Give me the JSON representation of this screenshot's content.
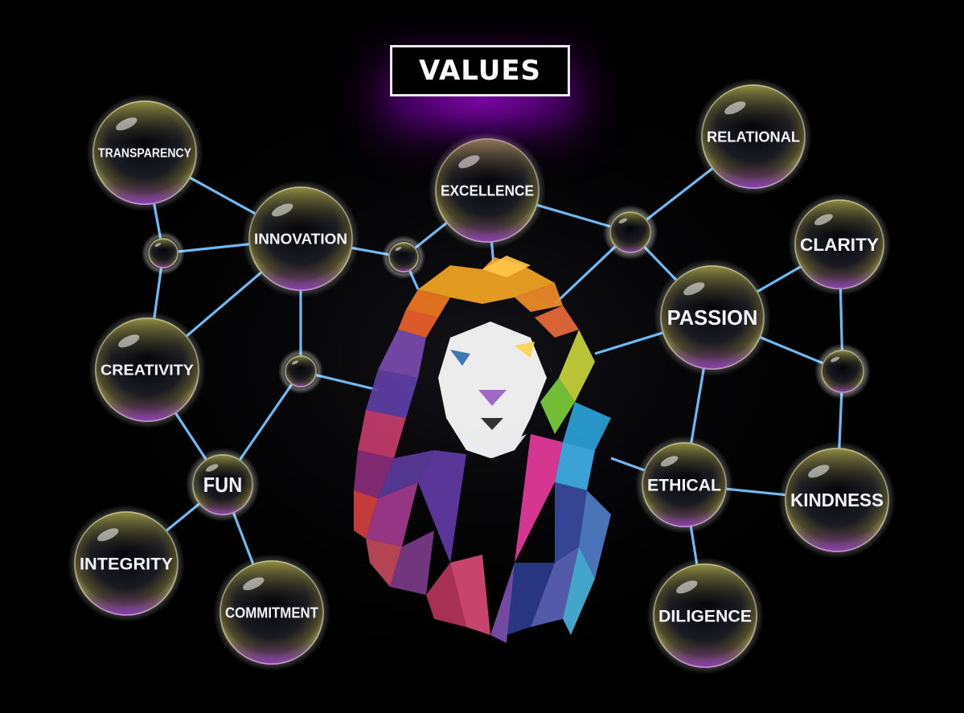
{
  "title": "VALUES",
  "colors": {
    "background": "#000000",
    "connector": "#6fb8f2",
    "bubble_top": "#a7a24a",
    "bubble_bottom": "#7a2fb0",
    "title_glow": "#a514e6"
  },
  "image": "lion-head-icon",
  "values": [
    {
      "id": "transparency",
      "label": "TRANSPARENCY"
    },
    {
      "id": "innovation",
      "label": "INNOVATION"
    },
    {
      "id": "excellence",
      "label": "EXCELLENCE"
    },
    {
      "id": "relational",
      "label": "RELATIONAL"
    },
    {
      "id": "clarity",
      "label": "CLARITY"
    },
    {
      "id": "passion",
      "label": "PASSION"
    },
    {
      "id": "creativity",
      "label": "CREATIVITY"
    },
    {
      "id": "fun",
      "label": "FUN"
    },
    {
      "id": "integrity",
      "label": "INTEGRITY"
    },
    {
      "id": "commitment",
      "label": "COMMITMENT"
    },
    {
      "id": "ethical",
      "label": "ETHICAL"
    },
    {
      "id": "kindness",
      "label": "KINDNESS"
    },
    {
      "id": "diligence",
      "label": "DILIGENCE"
    }
  ]
}
